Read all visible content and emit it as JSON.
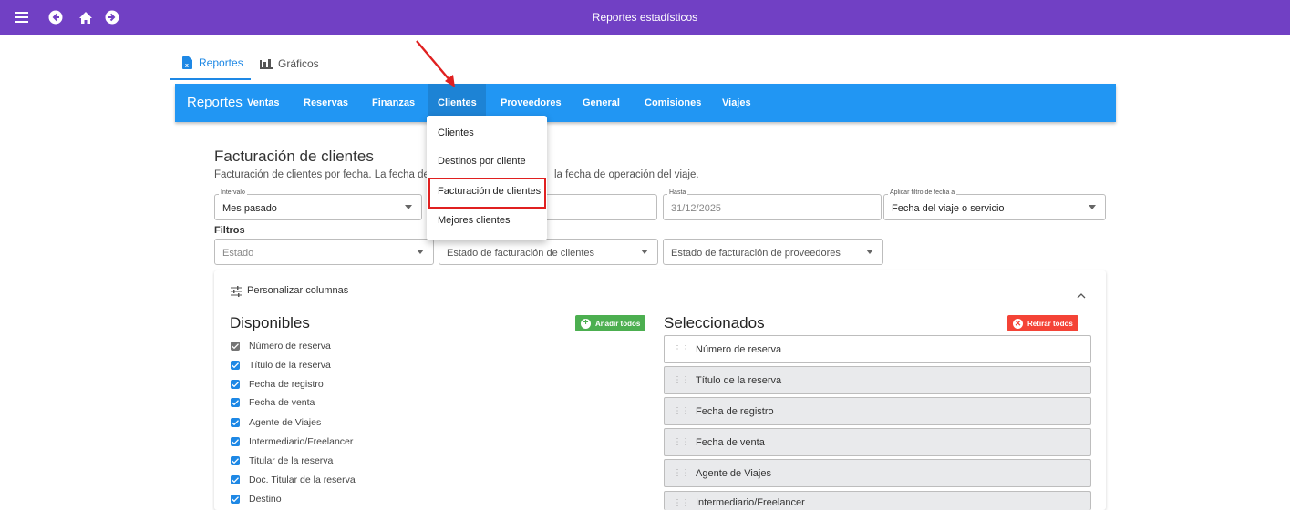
{
  "topbar": {
    "title": "Reportes estadísticos",
    "icons": [
      "menu-icon",
      "back-icon",
      "home-icon",
      "forward-icon"
    ]
  },
  "tabs": [
    {
      "label": "Reportes",
      "icon": "report-doc-icon",
      "active": true
    },
    {
      "label": "Gráficos",
      "icon": "bar-chart-icon",
      "active": false
    }
  ],
  "navbar": {
    "brand": "Reportes",
    "items": [
      "Ventas",
      "Reservas",
      "Finanzas",
      "Clientes",
      "Proveedores",
      "General",
      "Comisiones",
      "Viajes"
    ],
    "active": "Clientes"
  },
  "dropdown": {
    "items": [
      "Clientes",
      "Destinos por cliente",
      "Facturación de clientes",
      "Mejores clientes"
    ],
    "highlighted": "Facturación de clientes"
  },
  "section": {
    "title": "Facturación de clientes",
    "desc_left": "Facturación de clientes por fecha. La fecha de",
    "desc_right": "la fecha de operación del viaje."
  },
  "fields": {
    "intervalo": {
      "label": "Intervalo",
      "value": "Mes pasado"
    },
    "hasta": {
      "label": "Hasta",
      "value": "31/12/2025"
    },
    "aplicar": {
      "label": "Aplicar filtro de fecha a",
      "value": "Fecha del viaje o servicio"
    }
  },
  "filtros": {
    "title": "Filtros",
    "estado": "Estado",
    "estado_clientes": "Estado de facturación de clientes",
    "estado_proveedores": "Estado de facturación de proveedores"
  },
  "panel": {
    "header": "Personalizar columnas",
    "disponibles_title": "Disponibles",
    "add_all": "Añadir todos",
    "seleccionados_title": "Seleccionados",
    "remove_all": "Retirar todos",
    "available": [
      {
        "label": "Número de reserva",
        "state": "disabled"
      },
      {
        "label": "Título de la reserva",
        "state": "checked"
      },
      {
        "label": "Fecha de registro",
        "state": "checked"
      },
      {
        "label": "Fecha de venta",
        "state": "checked"
      },
      {
        "label": "Agente de Viajes",
        "state": "checked"
      },
      {
        "label": "Intermediario/Freelancer",
        "state": "checked"
      },
      {
        "label": "Titular de la reserva",
        "state": "checked"
      },
      {
        "label": "Doc. Titular de la reserva",
        "state": "checked"
      },
      {
        "label": "Destino",
        "state": "checked"
      }
    ],
    "selected": [
      "Número de reserva",
      "Título de la reserva",
      "Fecha de registro",
      "Fecha de venta",
      "Agente de Viajes",
      "Intermediario/Freelancer"
    ]
  },
  "colors": {
    "topbar": "#7140c4",
    "navbar": "#2196f3",
    "add_button": "#4caf50",
    "remove_button": "#f44336",
    "annotation": "#e02020"
  }
}
